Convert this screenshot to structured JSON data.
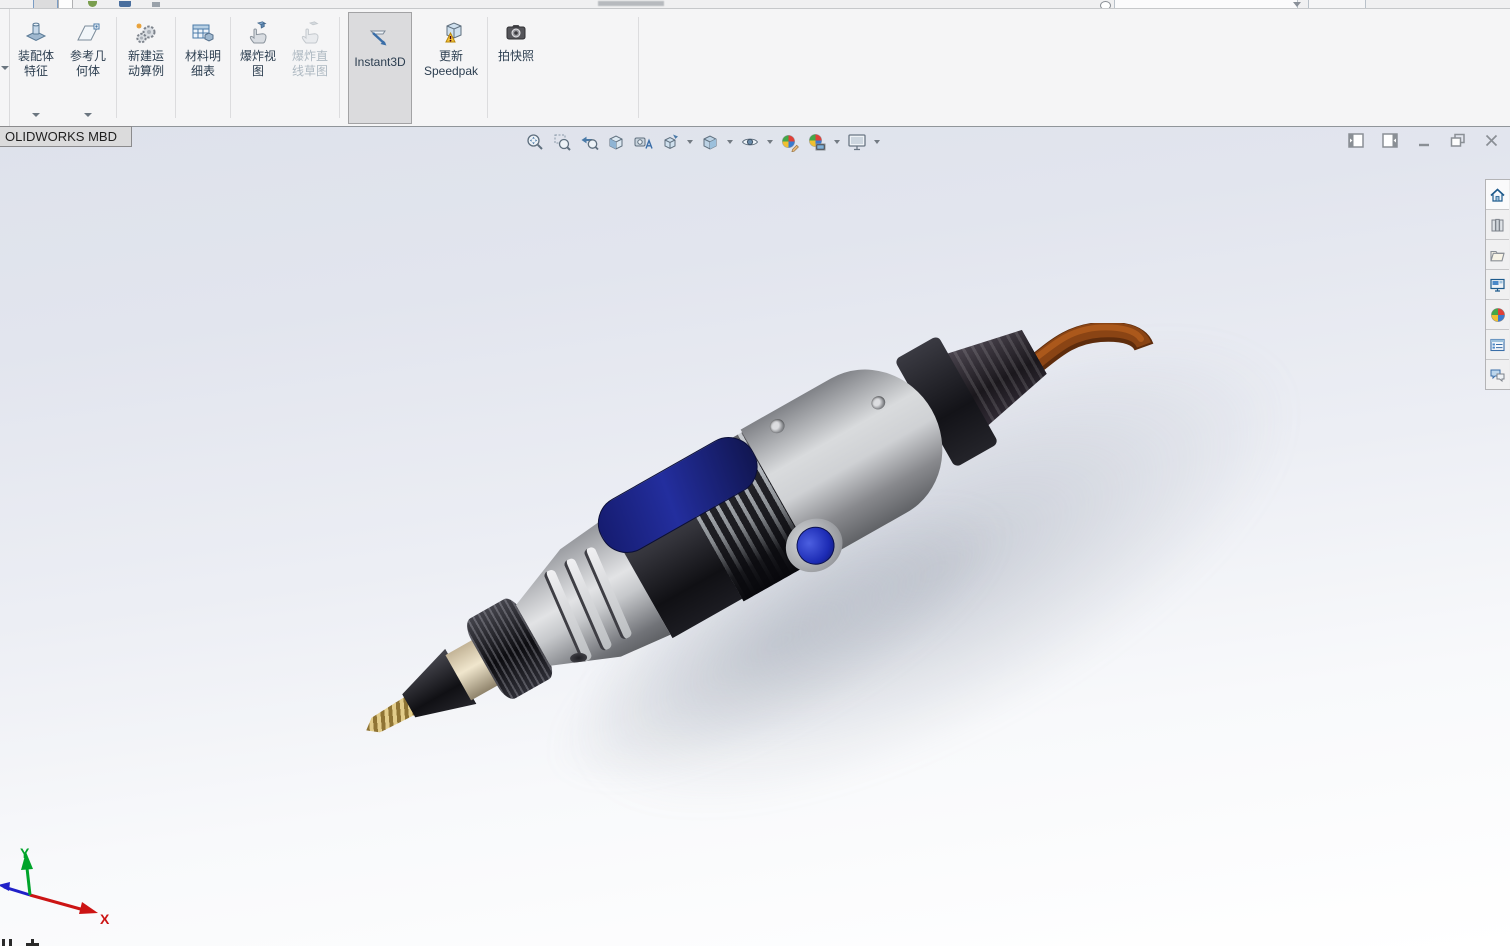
{
  "window": {
    "controls": [
      "collapse-left-pane",
      "expand-right-pane",
      "minimize",
      "restore",
      "close"
    ]
  },
  "topbar": {
    "search_value": ""
  },
  "ribbon": {
    "tab_label": "OLIDWORKS MBD",
    "buttons": [
      {
        "label": "装配体特征",
        "disabled": false,
        "flyout": true
      },
      {
        "label": "参考几何体",
        "disabled": false,
        "flyout": true
      },
      {
        "label": "新建运动算例",
        "disabled": false
      },
      {
        "label": "材料明细表",
        "disabled": false
      },
      {
        "label": "爆炸视图",
        "disabled": false
      },
      {
        "label": "爆炸直线草图",
        "disabled": true
      },
      {
        "label": "Instant3D",
        "selected": true
      },
      {
        "label": "更新 Speedpak",
        "disabled": false
      },
      {
        "label": "拍快照",
        "disabled": false
      }
    ]
  },
  "headsup": {
    "icons": [
      "zoom-to-fit",
      "zoom-to-area",
      "previous-view",
      "section-view",
      "dynamic-annotation-views",
      "view-orientation",
      "display-style",
      "hide-show-items",
      "edit-appearance",
      "apply-scene",
      "view-settings"
    ],
    "dropdowns": [
      "view-orientation",
      "display-style",
      "hide-show-items",
      "apply-scene",
      "view-settings"
    ]
  },
  "taskpane": {
    "icons": [
      "solidworks-resources-home",
      "design-library",
      "file-explorer",
      "view-palette",
      "appearances-scenes",
      "custom-properties",
      "solidworks-forum"
    ]
  },
  "viewport": {
    "triad": {
      "x_label": "X",
      "y_label": "Y"
    }
  },
  "model": {
    "name": "rotary-tool-assembly",
    "colors": {
      "body_gray": "#c8cacd",
      "housing_black": "#2b2b30",
      "label_navy": "#1b2490",
      "button_blue": "#2335c8",
      "cable_brown": "#8a4414",
      "collet_cream": "#e9ddc4",
      "bit_brass": "#c3a256",
      "triad_x_red": "#cc1414",
      "triad_y_green": "#00a42a",
      "triad_z_blue": "#2020c8"
    }
  }
}
